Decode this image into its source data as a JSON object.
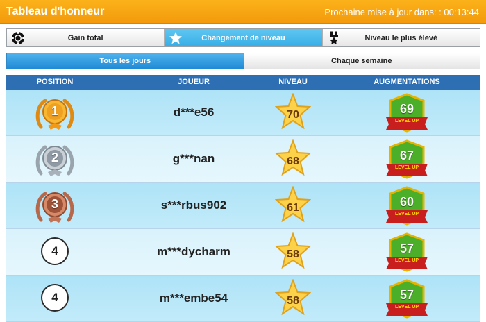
{
  "header": {
    "title": "Tableau d'honneur",
    "next_update_label": "Prochaine mise à jour dans: : 00:13:44"
  },
  "category_tabs": [
    {
      "label": "Gain total",
      "icon": "chip-icon",
      "active": false
    },
    {
      "label": "Changement de niveau",
      "icon": "star-icon",
      "active": true
    },
    {
      "label": "Niveau le plus élevé",
      "icon": "medal-icon",
      "active": false
    }
  ],
  "period_tabs": [
    {
      "label": "Tous les jours",
      "active": true
    },
    {
      "label": "Chaque semaine",
      "active": false
    }
  ],
  "columns": {
    "position": "POSITION",
    "player": "JOUEUR",
    "level": "NIVEAU",
    "increase": "AUGMENTATIONS"
  },
  "level_up_label": "LEVEL UP",
  "rows": [
    {
      "position": "1",
      "medal": "gold",
      "player": "d***e56",
      "level": "70",
      "increase": "69"
    },
    {
      "position": "2",
      "medal": "silver",
      "player": "g***nan",
      "level": "68",
      "increase": "67"
    },
    {
      "position": "3",
      "medal": "bronze",
      "player": "s***rbus902",
      "level": "61",
      "increase": "60"
    },
    {
      "position": "4",
      "medal": "none",
      "player": "m***dycharm",
      "level": "58",
      "increase": "57"
    },
    {
      "position": "4",
      "medal": "none",
      "player": "m***embe54",
      "level": "58",
      "increase": "57"
    }
  ],
  "colors": {
    "header_orange": "#f39a0c",
    "active_tab_blue": "#37aee7",
    "table_header_blue": "#2e6fb3",
    "row_dark": "#b5e6f8",
    "row_light": "#dff4fc",
    "level_up_green": "#4caf2a",
    "ribbon_red": "#c81e1e"
  }
}
